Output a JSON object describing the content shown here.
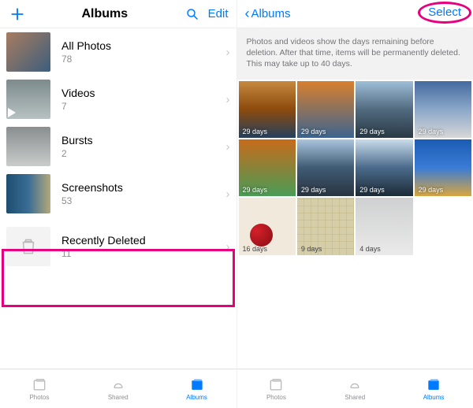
{
  "left": {
    "title": "Albums",
    "edit": "Edit",
    "albums": [
      {
        "name": "All Photos",
        "count": "78"
      },
      {
        "name": "Videos",
        "count": "7"
      },
      {
        "name": "Bursts",
        "count": "2"
      },
      {
        "name": "Screenshots",
        "count": "53"
      },
      {
        "name": "Recently Deleted",
        "count": "11"
      }
    ]
  },
  "right": {
    "back": "Albums",
    "select": "Select",
    "banner": "Photos and videos show the days remaining before deletion. After that time, items will be permanently deleted. This may take up to 40 days.",
    "cells": [
      "29 days",
      "29 days",
      "29 days",
      "29 days",
      "29 days",
      "29 days",
      "29 days",
      "29 days",
      "16 days",
      "9 days",
      "4 days"
    ]
  },
  "tabs": {
    "photos": "Photos",
    "shared": "Shared",
    "albums": "Albums"
  }
}
